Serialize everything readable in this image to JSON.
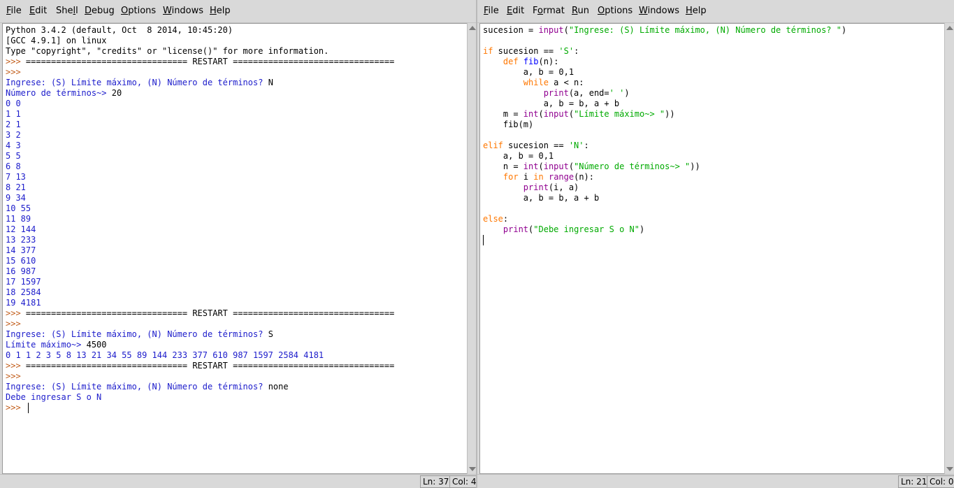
{
  "shell_window": {
    "menu": [
      {
        "pre": "",
        "u": "F",
        "post": "ile"
      },
      {
        "pre": "",
        "u": "E",
        "post": "dit"
      },
      {
        "pre": "She",
        "u": "l",
        "post": "l"
      },
      {
        "pre": "",
        "u": "D",
        "post": "ebug"
      },
      {
        "pre": "",
        "u": "O",
        "post": "ptions"
      },
      {
        "pre": "",
        "u": "W",
        "post": "indows"
      },
      {
        "pre": "",
        "u": "H",
        "post": "elp"
      }
    ],
    "lines": [
      [
        {
          "t": "Python 3.4.2 (default, Oct  8 2014, 10:45:20)",
          "c": "out"
        }
      ],
      [
        {
          "t": "[GCC 4.9.1] on linux",
          "c": "out"
        }
      ],
      [
        {
          "t": "Type \"copyright\", \"credits\" or \"license()\" for more information.",
          "c": "out"
        }
      ],
      [
        {
          "t": ">>> ",
          "c": "prompt"
        },
        {
          "t": "================================ RESTART ================================",
          "c": "out"
        }
      ],
      [
        {
          "t": ">>>",
          "c": "prompt"
        }
      ],
      [
        {
          "t": "Ingrese: (S) Límite máximo, (N) Número de términos? ",
          "c": "stdout"
        },
        {
          "t": "N",
          "c": "out"
        }
      ],
      [
        {
          "t": "Número de términos~> ",
          "c": "stdout"
        },
        {
          "t": "20",
          "c": "out"
        }
      ],
      [
        {
          "t": "0 0",
          "c": "stdout"
        }
      ],
      [
        {
          "t": "1 1",
          "c": "stdout"
        }
      ],
      [
        {
          "t": "2 1",
          "c": "stdout"
        }
      ],
      [
        {
          "t": "3 2",
          "c": "stdout"
        }
      ],
      [
        {
          "t": "4 3",
          "c": "stdout"
        }
      ],
      [
        {
          "t": "5 5",
          "c": "stdout"
        }
      ],
      [
        {
          "t": "6 8",
          "c": "stdout"
        }
      ],
      [
        {
          "t": "7 13",
          "c": "stdout"
        }
      ],
      [
        {
          "t": "8 21",
          "c": "stdout"
        }
      ],
      [
        {
          "t": "9 34",
          "c": "stdout"
        }
      ],
      [
        {
          "t": "10 55",
          "c": "stdout"
        }
      ],
      [
        {
          "t": "11 89",
          "c": "stdout"
        }
      ],
      [
        {
          "t": "12 144",
          "c": "stdout"
        }
      ],
      [
        {
          "t": "13 233",
          "c": "stdout"
        }
      ],
      [
        {
          "t": "14 377",
          "c": "stdout"
        }
      ],
      [
        {
          "t": "15 610",
          "c": "stdout"
        }
      ],
      [
        {
          "t": "16 987",
          "c": "stdout"
        }
      ],
      [
        {
          "t": "17 1597",
          "c": "stdout"
        }
      ],
      [
        {
          "t": "18 2584",
          "c": "stdout"
        }
      ],
      [
        {
          "t": "19 4181",
          "c": "stdout"
        }
      ],
      [
        {
          "t": ">>> ",
          "c": "prompt"
        },
        {
          "t": "================================ RESTART ================================",
          "c": "out"
        }
      ],
      [
        {
          "t": ">>>",
          "c": "prompt"
        }
      ],
      [
        {
          "t": "Ingrese: (S) Límite máximo, (N) Número de términos? ",
          "c": "stdout"
        },
        {
          "t": "S",
          "c": "out"
        }
      ],
      [
        {
          "t": "Límite máximo~> ",
          "c": "stdout"
        },
        {
          "t": "4500",
          "c": "out"
        }
      ],
      [
        {
          "t": "0 1 1 2 3 5 8 13 21 34 55 89 144 233 377 610 987 1597 2584 4181",
          "c": "stdout"
        }
      ],
      [
        {
          "t": ">>> ",
          "c": "prompt"
        },
        {
          "t": "================================ RESTART ================================",
          "c": "out"
        }
      ],
      [
        {
          "t": ">>>",
          "c": "prompt"
        }
      ],
      [
        {
          "t": "Ingrese: (S) Límite máximo, (N) Número de términos? ",
          "c": "stdout"
        },
        {
          "t": "none",
          "c": "out"
        }
      ],
      [
        {
          "t": "Debe ingresar S o N",
          "c": "stdout"
        }
      ],
      [
        {
          "t": ">>> ",
          "c": "prompt"
        }
      ]
    ],
    "status": {
      "ln": "Ln: 37",
      "col": "Col: 4"
    }
  },
  "editor_window": {
    "menu": [
      {
        "pre": "",
        "u": "F",
        "post": "ile"
      },
      {
        "pre": "",
        "u": "E",
        "post": "dit"
      },
      {
        "pre": "F",
        "u": "o",
        "post": "rmat"
      },
      {
        "pre": "",
        "u": "R",
        "post": "un"
      },
      {
        "pre": "",
        "u": "O",
        "post": "ptions"
      },
      {
        "pre": "",
        "u": "W",
        "post": "indows"
      },
      {
        "pre": "",
        "u": "H",
        "post": "elp"
      }
    ],
    "lines": [
      [
        {
          "t": "sucesion = ",
          "c": "out"
        },
        {
          "t": "input",
          "c": "builtin"
        },
        {
          "t": "(",
          "c": "out"
        },
        {
          "t": "\"Ingrese: (S) Límite máximo, (N) Número de términos? \"",
          "c": "str"
        },
        {
          "t": ")",
          "c": "out"
        }
      ],
      [],
      [
        {
          "t": "if",
          "c": "kw"
        },
        {
          "t": " sucesion == ",
          "c": "out"
        },
        {
          "t": "'S'",
          "c": "str"
        },
        {
          "t": ":",
          "c": "out"
        }
      ],
      [
        {
          "t": "    ",
          "c": "out"
        },
        {
          "t": "def",
          "c": "kw"
        },
        {
          "t": " ",
          "c": "out"
        },
        {
          "t": "fib",
          "c": "def"
        },
        {
          "t": "(n):",
          "c": "out"
        }
      ],
      [
        {
          "t": "        a, b = 0,1",
          "c": "out"
        }
      ],
      [
        {
          "t": "        ",
          "c": "out"
        },
        {
          "t": "while",
          "c": "kw"
        },
        {
          "t": " a < n:",
          "c": "out"
        }
      ],
      [
        {
          "t": "            ",
          "c": "out"
        },
        {
          "t": "print",
          "c": "builtin"
        },
        {
          "t": "(a, end=",
          "c": "out"
        },
        {
          "t": "' '",
          "c": "str"
        },
        {
          "t": ")",
          "c": "out"
        }
      ],
      [
        {
          "t": "            a, b = b, a + b",
          "c": "out"
        }
      ],
      [
        {
          "t": "    m = ",
          "c": "out"
        },
        {
          "t": "int",
          "c": "builtin"
        },
        {
          "t": "(",
          "c": "out"
        },
        {
          "t": "input",
          "c": "builtin"
        },
        {
          "t": "(",
          "c": "out"
        },
        {
          "t": "\"Límite máximo~> \"",
          "c": "str"
        },
        {
          "t": "))",
          "c": "out"
        }
      ],
      [
        {
          "t": "    fib(m)",
          "c": "out"
        }
      ],
      [],
      [
        {
          "t": "elif",
          "c": "kw"
        },
        {
          "t": " sucesion == ",
          "c": "out"
        },
        {
          "t": "'N'",
          "c": "str"
        },
        {
          "t": ":",
          "c": "out"
        }
      ],
      [
        {
          "t": "    a, b = 0,1",
          "c": "out"
        }
      ],
      [
        {
          "t": "    n = ",
          "c": "out"
        },
        {
          "t": "int",
          "c": "builtin"
        },
        {
          "t": "(",
          "c": "out"
        },
        {
          "t": "input",
          "c": "builtin"
        },
        {
          "t": "(",
          "c": "out"
        },
        {
          "t": "\"Número de términos~> \"",
          "c": "str"
        },
        {
          "t": "))",
          "c": "out"
        }
      ],
      [
        {
          "t": "    ",
          "c": "out"
        },
        {
          "t": "for",
          "c": "kw"
        },
        {
          "t": " i ",
          "c": "out"
        },
        {
          "t": "in",
          "c": "kw"
        },
        {
          "t": " ",
          "c": "out"
        },
        {
          "t": "range",
          "c": "builtin"
        },
        {
          "t": "(n):",
          "c": "out"
        }
      ],
      [
        {
          "t": "        ",
          "c": "out"
        },
        {
          "t": "print",
          "c": "builtin"
        },
        {
          "t": "(i, a)",
          "c": "out"
        }
      ],
      [
        {
          "t": "        a, b = b, a + b",
          "c": "out"
        }
      ],
      [],
      [
        {
          "t": "else",
          "c": "kw"
        },
        {
          "t": ":",
          "c": "out"
        }
      ],
      [
        {
          "t": "    ",
          "c": "out"
        },
        {
          "t": "print",
          "c": "builtin"
        },
        {
          "t": "(",
          "c": "out"
        },
        {
          "t": "\"Debe ingresar S o N\"",
          "c": "str"
        },
        {
          "t": ")",
          "c": "out"
        }
      ],
      []
    ],
    "status": {
      "ln": "Ln: 21",
      "col": "Col: 0"
    }
  }
}
